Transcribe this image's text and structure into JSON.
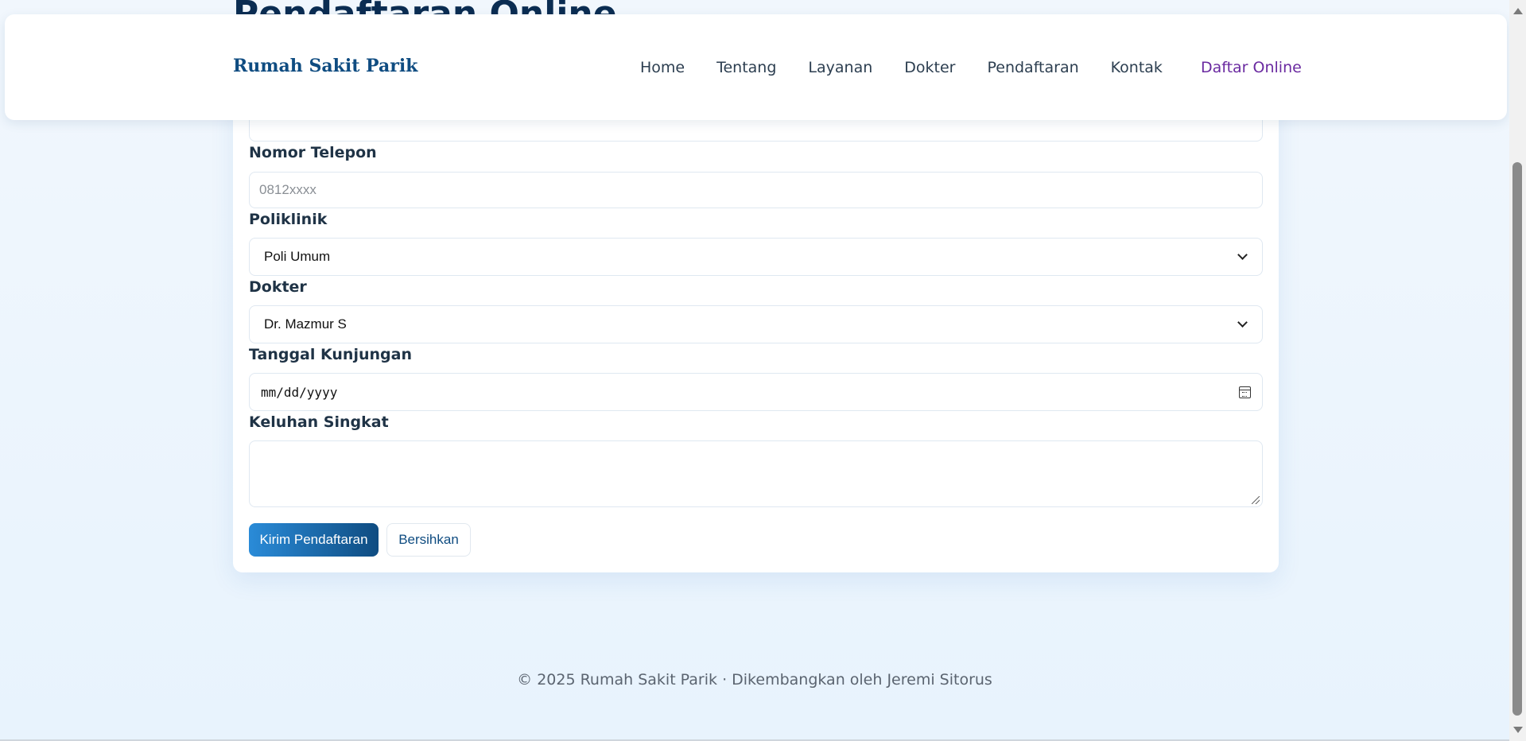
{
  "page": {
    "title": "Pendaftaran Online"
  },
  "navbar": {
    "brand": "Rumah Sakit Parik",
    "links": [
      "Home",
      "Tentang",
      "Layanan",
      "Dokter",
      "Pendaftaran",
      "Kontak"
    ],
    "cta": "Daftar Online"
  },
  "form": {
    "phone": {
      "label": "Nomor Telepon",
      "placeholder": "0812xxxx",
      "value": ""
    },
    "poliklinik": {
      "label": "Poliklinik",
      "selected": "Poli Umum"
    },
    "dokter": {
      "label": "Dokter",
      "selected": "Dr. Mazmur S"
    },
    "tanggal": {
      "label": "Tanggal Kunjungan",
      "placeholder": "mm/dd/yyyy"
    },
    "keluhan": {
      "label": "Keluhan Singkat",
      "value": ""
    },
    "submit_label": "Kirim Pendaftaran",
    "reset_label": "Bersihkan"
  },
  "footer": {
    "text": "© 2025 Rumah Sakit Parik · Dikembangkan oleh Jeremi Sitorus"
  },
  "colors": {
    "brand": "#0f4c81",
    "cta": "#6a2aa0",
    "background": "#e8f3fd"
  }
}
